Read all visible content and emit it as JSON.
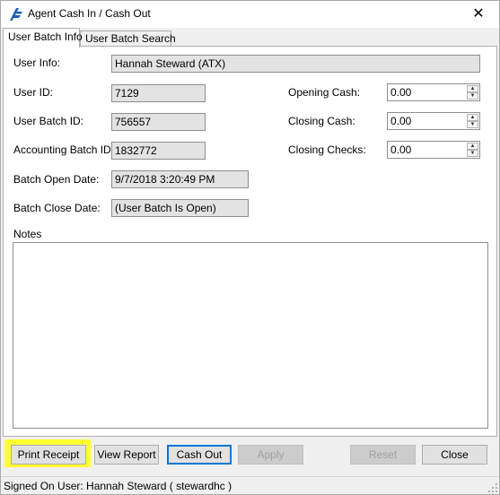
{
  "window": {
    "title": "Agent Cash In / Cash Out",
    "close_glyph": "✕",
    "icon": "app-logo-icon",
    "accent_color": "#1e5fb4"
  },
  "tabs": [
    {
      "label": "User Batch Info",
      "active": true
    },
    {
      "label": "User Batch Search",
      "active": false
    }
  ],
  "fields": {
    "user_info_label": "User Info:",
    "user_info_value": "Hannah Steward (ATX)",
    "user_id_label": "User ID:",
    "user_id_value": "7129",
    "user_batch_id_label": "User Batch ID:",
    "user_batch_id_value": "756557",
    "accounting_batch_id_label": "Accounting Batch ID:",
    "accounting_batch_id_value": "1832772",
    "batch_open_date_label": "Batch Open Date:",
    "batch_open_date_value": "9/7/2018 3:20:49 PM",
    "batch_close_date_label": "Batch Close Date:",
    "batch_close_date_value": "(User Batch Is Open)",
    "opening_cash_label": "Opening Cash:",
    "opening_cash_value": "0.00",
    "closing_cash_label": "Closing Cash:",
    "closing_cash_value": "0.00",
    "closing_checks_label": "Closing Checks:",
    "closing_checks_value": "0.00",
    "notes_label": "Notes",
    "notes_value": ""
  },
  "buttons": {
    "print_receipt": "Print Receipt",
    "view_report": "View Report",
    "cash_out": "Cash Out",
    "apply": "Apply",
    "reset": "Reset",
    "close": "Close"
  },
  "highlight_color": "#ffff33",
  "status": {
    "text": "Signed On User: Hannah Steward ( stewardhc )"
  }
}
